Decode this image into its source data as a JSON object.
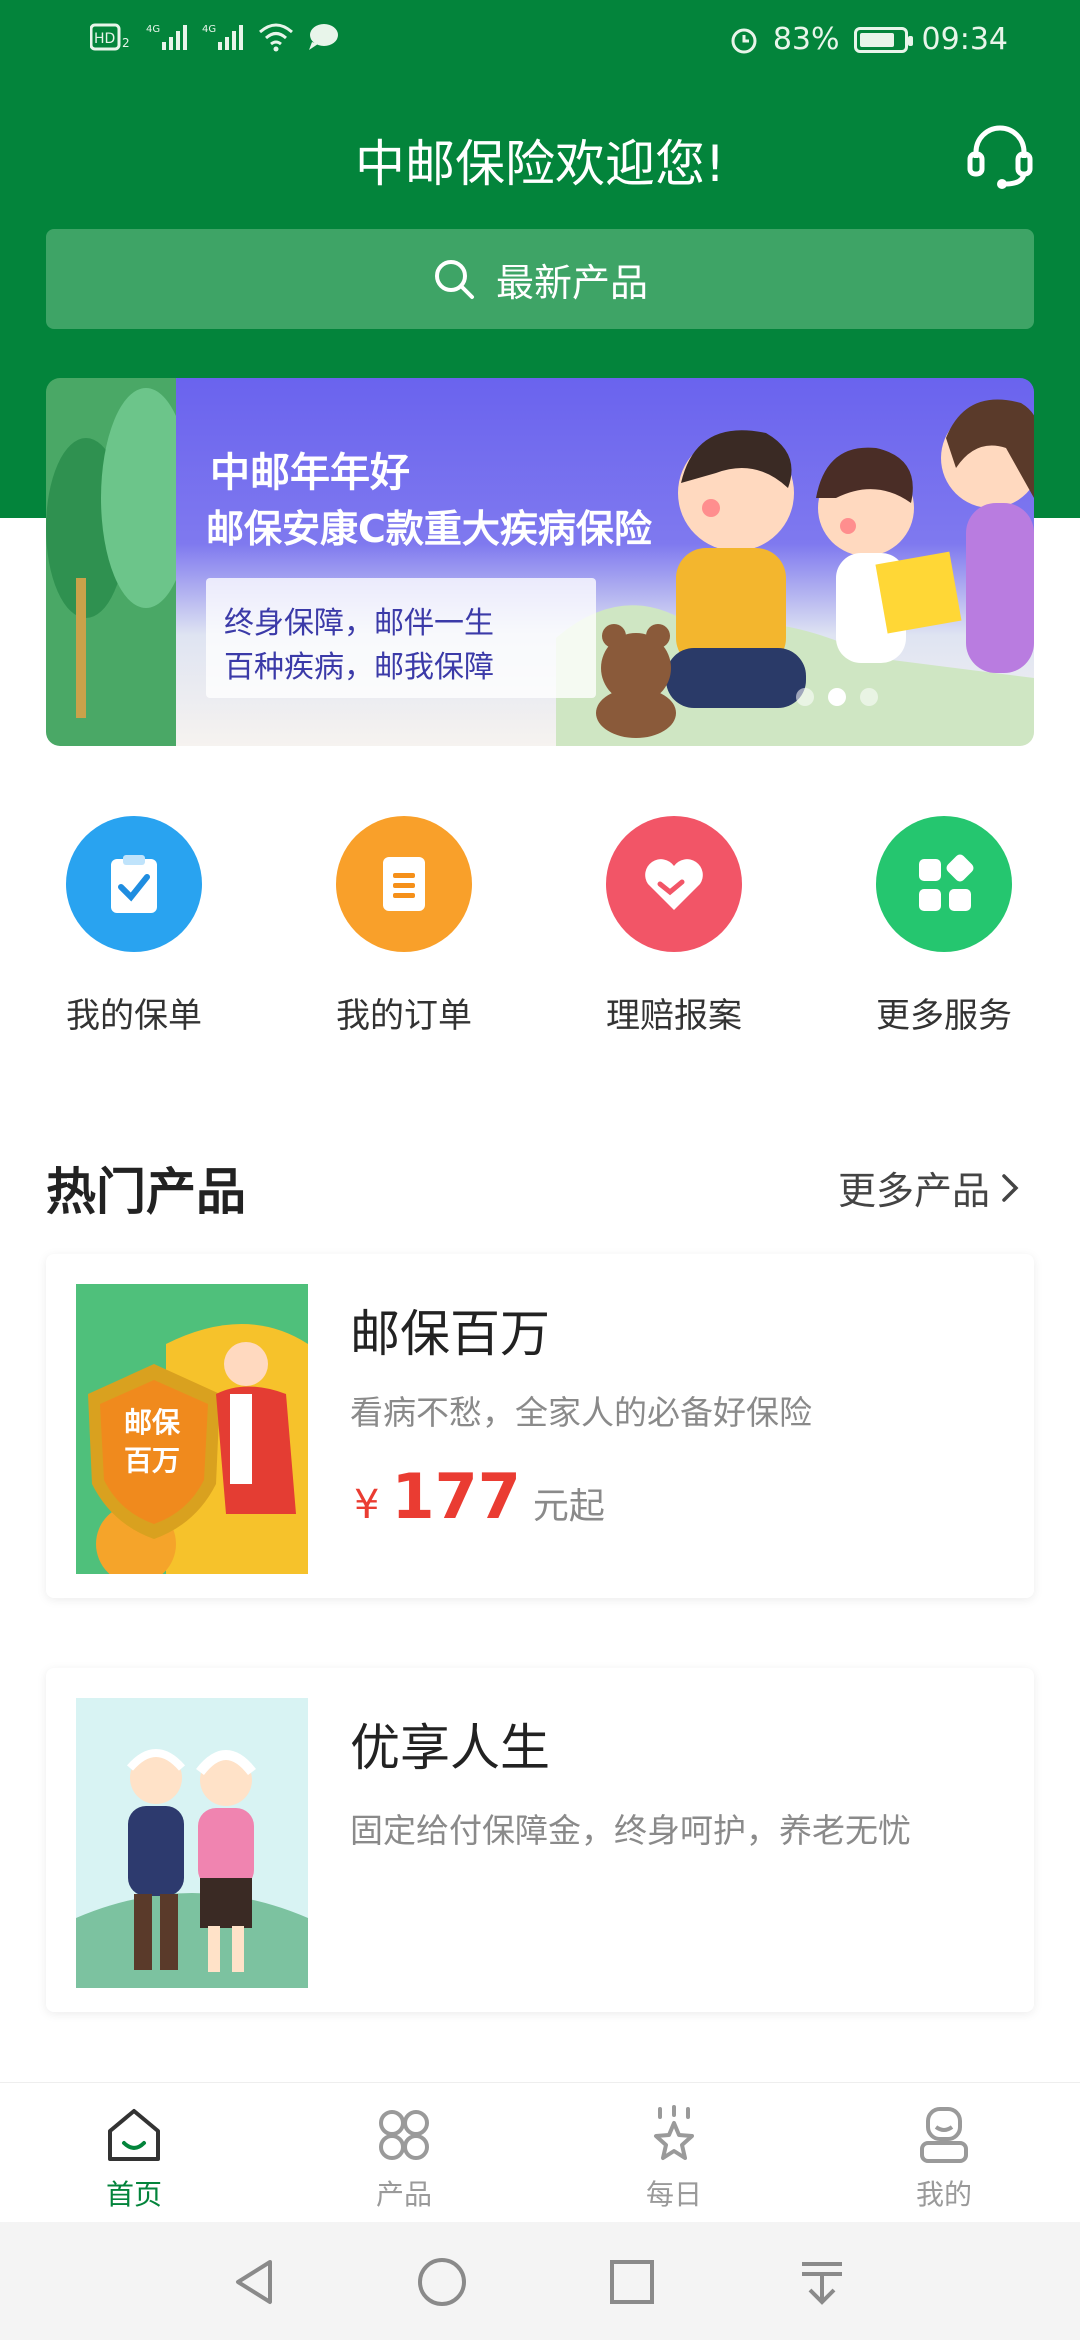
{
  "status_bar": {
    "left_icons": [
      "HD-icon",
      "signal-4g-icon",
      "signal-4g-icon",
      "wifi-icon",
      "message-icon"
    ],
    "battery": "83%",
    "battery_level": 0.83,
    "time": "09:34"
  },
  "header": {
    "title": "中邮保险欢迎您!",
    "search_placeholder": "最新产品"
  },
  "banner": {
    "line1": "中邮年年好",
    "line2": "邮保安康C款重大疾病保险",
    "sub1": "终身保障，邮伴一生",
    "sub2": "百种疾病，邮我保障",
    "slides": 3,
    "active_slide": 2
  },
  "quick_actions": [
    {
      "label": "我的保单",
      "icon": "clipboard-check-icon",
      "color": "#29a3f0"
    },
    {
      "label": "我的订单",
      "icon": "document-list-icon",
      "color": "#f9a02a"
    },
    {
      "label": "理赔报案",
      "icon": "heart-handshake-icon",
      "color": "#f25567"
    },
    {
      "label": "更多服务",
      "icon": "grid-apps-icon",
      "color": "#25c66f"
    }
  ],
  "hot_products": {
    "title": "热门产品",
    "more": "更多产品",
    "items": [
      {
        "name": "邮保百万",
        "desc": "看病不愁，全家人的必备好保险",
        "currency": "¥",
        "price": "177",
        "price_unit": "元起",
        "badge_text_1": "邮保",
        "badge_text_2": "百万"
      },
      {
        "name": "优享人生",
        "desc": "固定给付保障金，终身呵护，养老无忧"
      }
    ]
  },
  "tabs": [
    {
      "label": "首页",
      "icon": "home-icon",
      "active": true
    },
    {
      "label": "产品",
      "icon": "products-icon",
      "active": false
    },
    {
      "label": "每日",
      "icon": "daily-star-icon",
      "active": false
    },
    {
      "label": "我的",
      "icon": "profile-icon",
      "active": false
    }
  ],
  "colors": {
    "brand_green": "#03843b",
    "search_bg": "#3ea466",
    "price_red": "#ea3c32"
  }
}
